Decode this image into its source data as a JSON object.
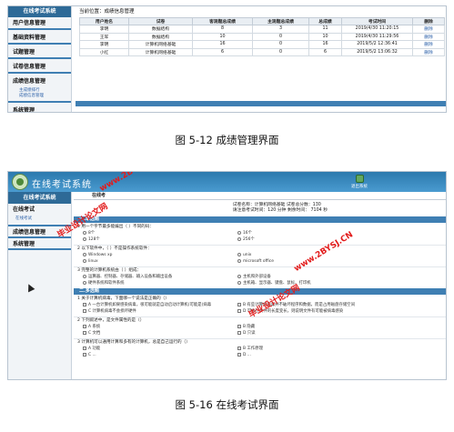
{
  "shot1": {
    "sidebar": {
      "title": "在线考试系统",
      "items": [
        {
          "label": "用户信息管理",
          "subs": []
        },
        {
          "label": "基础资料管理",
          "subs": []
        },
        {
          "label": "试题管理",
          "subs": []
        },
        {
          "label": "试卷信息管理",
          "subs": []
        },
        {
          "label": "成绩信息管理",
          "subs": [
            "主成绩排行",
            "成绩信息管理"
          ]
        },
        {
          "label": "系统管理",
          "subs": []
        }
      ]
    },
    "breadcrumb": "当前位置：成绩信息管理",
    "table": {
      "headers": [
        "用户姓名",
        "试卷",
        "客观题总成绩",
        "主观题总成绩",
        "总成绩",
        "考试时间",
        "删除"
      ],
      "rows": [
        [
          "李明",
          "数据结构",
          "8",
          "3",
          "11",
          "2019/4/30 11:20:15",
          "删除"
        ],
        [
          "王军",
          "数据结构",
          "10",
          "0",
          "10",
          "2019/4/30 11:29:56",
          "删除"
        ],
        [
          "李明",
          "计算机网络基础",
          "16",
          "0",
          "16",
          "2019/5/2 12:36:41",
          "删除"
        ],
        [
          "小红",
          "计算机网络基础",
          "6",
          "0",
          "6",
          "2019/5/2 13:06:32",
          "删除"
        ]
      ]
    }
  },
  "caption1": "图 5-12 成绩管理界面",
  "shot2": {
    "title": "在线考试系统",
    "exit_label": "退出系统",
    "sidebar": {
      "title": "在线考试系统",
      "items": [
        {
          "label": "在线考试",
          "subs": [
            "在线考试"
          ]
        },
        {
          "label": "成绩信息管理",
          "subs": []
        },
        {
          "label": "系统管理",
          "subs": []
        }
      ]
    },
    "top_label": "在线考",
    "info": {
      "line1": "试卷名称：计算机网络基础    试卷总分数：130",
      "line2": "请注意考试时间：120 分钟   剩余时间：   7104     秒"
    },
    "sections": [
      "一.单选题",
      "二.多选题"
    ],
    "questions": [
      {
        "text": "1  用一个字节最多能编出（  ）不同的码：",
        "options": [
          "8个",
          "16个",
          "128个",
          "256个"
        ]
      },
      {
        "text": "2  以下软件中，（  ）不是操作系统软件：",
        "options": [
          "Windows xp",
          "unix",
          "linux",
          "microsoft office"
        ]
      },
      {
        "text": "3  完整的计算机系统由（    ）组成：",
        "options": [
          "运算器、控制器、存储器、输入设备和输出设备",
          "主机和外部设备",
          "硬件系统和软件系统",
          "主机箱、显示器、键盘、鼠标、打印机"
        ]
      },
      {
        "text": "1  关于计算机病毒，下面哪一个说法是正确的（）",
        "options": [
          "A  一台计算机如果感染病毒，很可能就是自动启动计算机(可能是)病毒",
          "B  有些计算机病毒并不破坏程序和数据，而是占用磁盘存储空间",
          "C  计算机病毒不会损坏硬件",
          "D  可执行文件的长度变长，则说明文件有可能被病毒感染"
        ]
      },
      {
        "text": "2  下列叙述中，是文件属性的是（）",
        "options": [
          "A  系统",
          "B  隐藏",
          "C  文档",
          "D  只读"
        ]
      },
      {
        "text": "3  计算机可以通用计算和多有的计算机，总是自己运行的（）",
        "options": [
          "A  功能",
          "B  工作原理",
          "C  ...",
          "D  ..."
        ]
      }
    ]
  },
  "caption2": "图 5-16 在线考试界面",
  "watermarks": [
    "毕业设计论文网",
    "www.2BYSJ.CN",
    "毕业设计论文网",
    "www.2BYSJ.CN"
  ],
  "colors": {
    "header_blue": "#2c79ad",
    "bar_blue": "#3f7fb3",
    "watermark_red": "#e21b1b"
  }
}
